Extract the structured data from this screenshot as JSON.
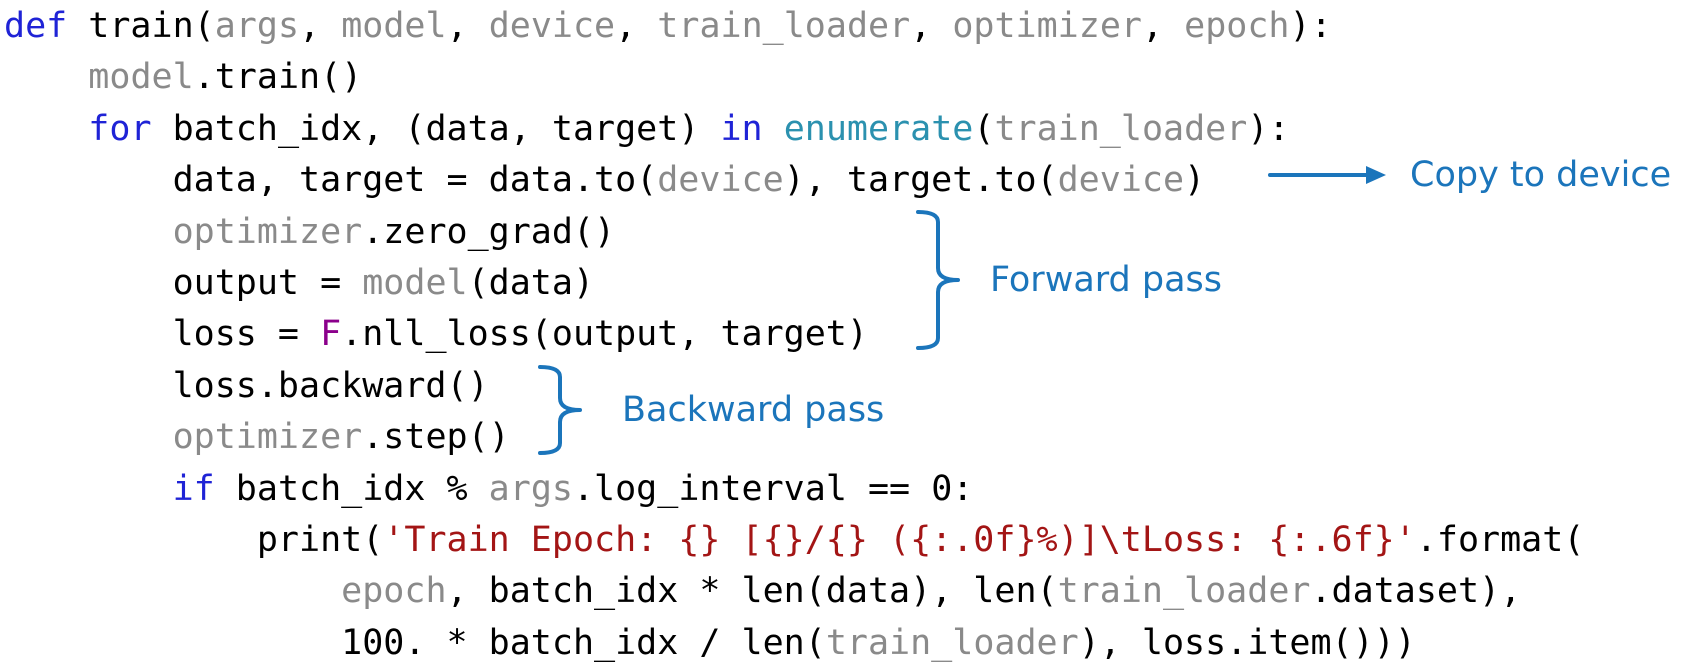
{
  "colors": {
    "keyword": "#1f23d6",
    "plain": "#000000",
    "dim": "#8a8a8a",
    "builtin": "#2b91af",
    "string": "#a31515",
    "special": "#8b008b",
    "annotation": "#1b75bb"
  },
  "code": {
    "lines": [
      {
        "tokens": [
          {
            "t": "def",
            "k": "keyword"
          },
          {
            "t": " train(",
            "k": "plain"
          },
          {
            "t": "args",
            "k": "dim"
          },
          {
            "t": ", ",
            "k": "plain"
          },
          {
            "t": "model",
            "k": "dim"
          },
          {
            "t": ", ",
            "k": "plain"
          },
          {
            "t": "device",
            "k": "dim"
          },
          {
            "t": ", ",
            "k": "plain"
          },
          {
            "t": "train_loader",
            "k": "dim"
          },
          {
            "t": ", ",
            "k": "plain"
          },
          {
            "t": "optimizer",
            "k": "dim"
          },
          {
            "t": ", ",
            "k": "plain"
          },
          {
            "t": "epoch",
            "k": "dim"
          },
          {
            "t": "):",
            "k": "plain"
          }
        ]
      },
      {
        "tokens": [
          {
            "t": "    ",
            "k": "plain"
          },
          {
            "t": "model",
            "k": "dim"
          },
          {
            "t": ".train()",
            "k": "plain"
          }
        ]
      },
      {
        "tokens": [
          {
            "t": "    ",
            "k": "plain"
          },
          {
            "t": "for",
            "k": "keyword"
          },
          {
            "t": " batch_idx, (data, target) ",
            "k": "plain"
          },
          {
            "t": "in",
            "k": "keyword"
          },
          {
            "t": " ",
            "k": "plain"
          },
          {
            "t": "enumerate",
            "k": "builtin"
          },
          {
            "t": "(",
            "k": "plain"
          },
          {
            "t": "train_loader",
            "k": "dim"
          },
          {
            "t": "):",
            "k": "plain"
          }
        ]
      },
      {
        "tokens": [
          {
            "t": "        data, target = data.to(",
            "k": "plain"
          },
          {
            "t": "device",
            "k": "dim"
          },
          {
            "t": "), target.to(",
            "k": "plain"
          },
          {
            "t": "device",
            "k": "dim"
          },
          {
            "t": ")",
            "k": "plain"
          }
        ]
      },
      {
        "tokens": [
          {
            "t": "        ",
            "k": "plain"
          },
          {
            "t": "optimizer",
            "k": "dim"
          },
          {
            "t": ".zero_grad()",
            "k": "plain"
          }
        ]
      },
      {
        "tokens": [
          {
            "t": "        output = ",
            "k": "plain"
          },
          {
            "t": "model",
            "k": "dim"
          },
          {
            "t": "(data)",
            "k": "plain"
          }
        ]
      },
      {
        "tokens": [
          {
            "t": "        loss = ",
            "k": "plain"
          },
          {
            "t": "F",
            "k": "special"
          },
          {
            "t": ".nll_loss(output, target)",
            "k": "plain"
          }
        ]
      },
      {
        "tokens": [
          {
            "t": "        loss.backward()",
            "k": "plain"
          }
        ]
      },
      {
        "tokens": [
          {
            "t": "        ",
            "k": "plain"
          },
          {
            "t": "optimizer",
            "k": "dim"
          },
          {
            "t": ".step()",
            "k": "plain"
          }
        ]
      },
      {
        "tokens": [
          {
            "t": "        ",
            "k": "plain"
          },
          {
            "t": "if",
            "k": "keyword"
          },
          {
            "t": " batch_idx % ",
            "k": "plain"
          },
          {
            "t": "args",
            "k": "dim"
          },
          {
            "t": ".log_interval == 0:",
            "k": "plain"
          }
        ]
      },
      {
        "tokens": [
          {
            "t": "            print(",
            "k": "plain"
          },
          {
            "t": "'Train Epoch: {} [{}/{} ({:.0f}%)]\\tLoss: {:.6f}'",
            "k": "string"
          },
          {
            "t": ".format(",
            "k": "plain"
          }
        ]
      },
      {
        "tokens": [
          {
            "t": "                ",
            "k": "plain"
          },
          {
            "t": "epoch",
            "k": "dim"
          },
          {
            "t": ", batch_idx * len(data), len(",
            "k": "plain"
          },
          {
            "t": "train_loader",
            "k": "dim"
          },
          {
            "t": ".dataset),",
            "k": "plain"
          }
        ]
      },
      {
        "tokens": [
          {
            "t": "                100. * batch_idx / len(",
            "k": "plain"
          },
          {
            "t": "train_loader",
            "k": "dim"
          },
          {
            "t": "), loss.item()))",
            "k": "plain"
          }
        ]
      }
    ]
  },
  "annotations": {
    "copy_to_device": "Copy to device",
    "forward_pass": "Forward pass",
    "backward_pass": "Backward pass"
  }
}
